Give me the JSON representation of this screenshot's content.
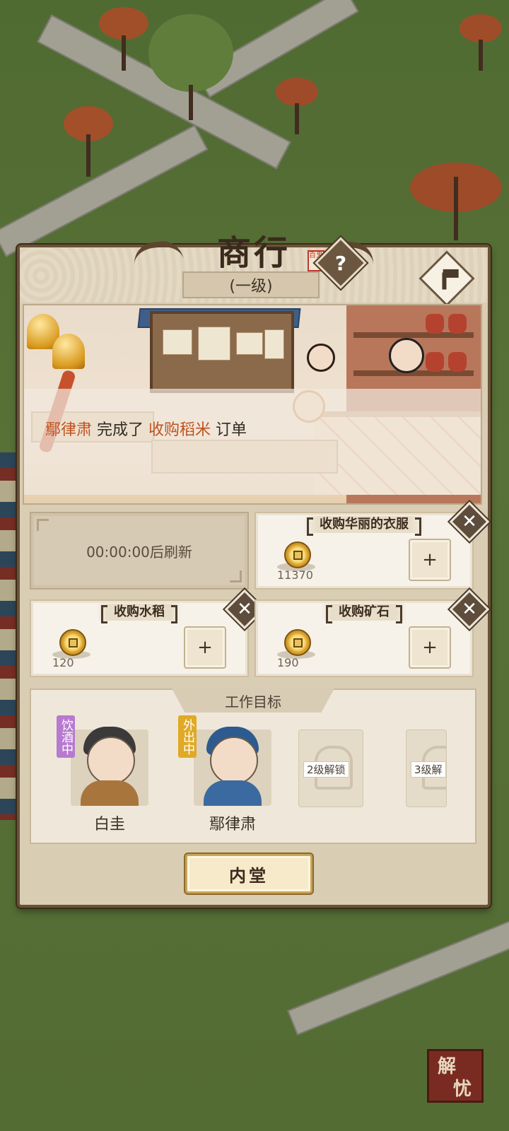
{
  "panel": {
    "title": "商行",
    "title_seal": "百鬼",
    "help_icon": "?",
    "level": "(一级)"
  },
  "notice": {
    "actor": "鄢律肃",
    "verb": "完成了",
    "order": "收购稻米",
    "suffix": "订单"
  },
  "orders": [
    {
      "name": "",
      "refresh_text": "00:00:00后刷新",
      "quantity": ""
    },
    {
      "name": "收购华丽的衣服",
      "quantity": "11370"
    },
    {
      "name": "收购水稻",
      "quantity": "120"
    },
    {
      "name": "收购矿石",
      "quantity": "190"
    }
  ],
  "work": {
    "title": "工作目标",
    "characters": [
      {
        "name": "白圭",
        "status": "饮酒中",
        "status_color": "#b77ad0"
      },
      {
        "name": "鄢律肃",
        "status": "外出中",
        "status_color": "#e0a926"
      }
    ],
    "locked": [
      {
        "label": "2级解锁"
      },
      {
        "label": "3级解"
      }
    ]
  },
  "buttons": {
    "inner_hall": "内堂",
    "plus": "+",
    "close": "✕"
  },
  "corner_badge": {
    "text_top": "解",
    "text_bottom": "忧"
  }
}
